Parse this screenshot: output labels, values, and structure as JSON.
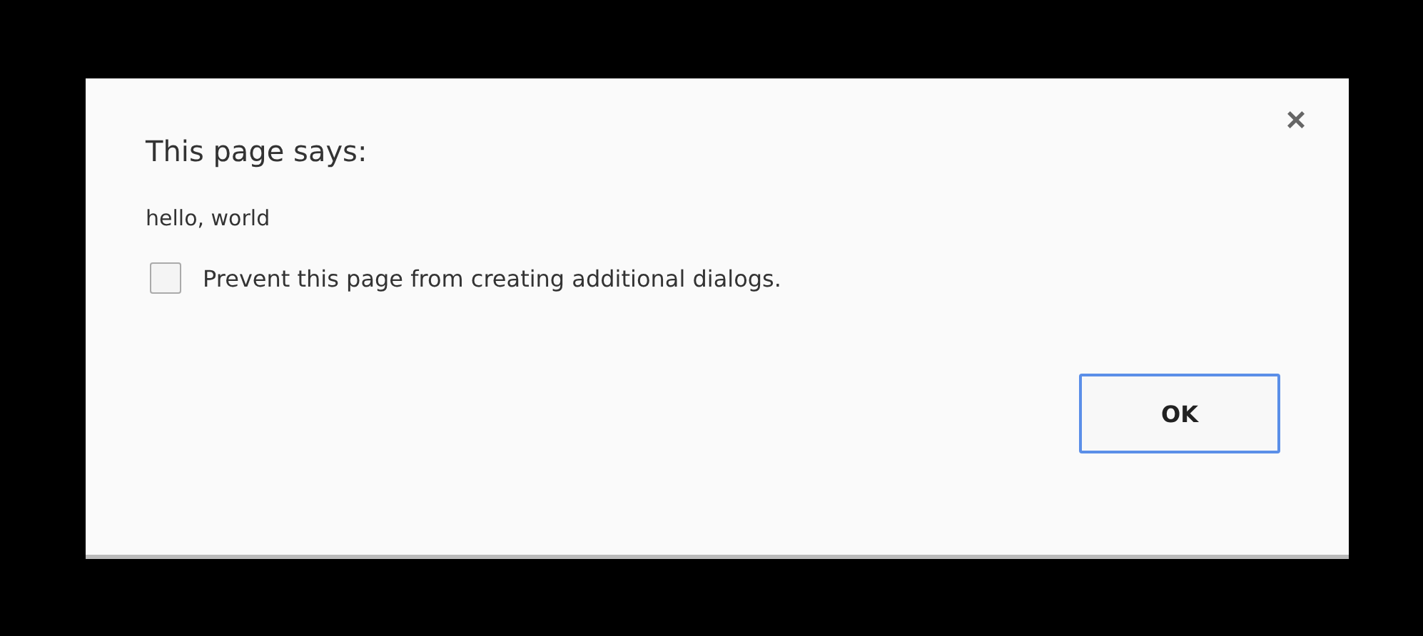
{
  "dialog": {
    "title": "This page says:",
    "close": "×",
    "message": "hello, world",
    "checkbox": {
      "label": "Prevent this page from creating additional dialogs.",
      "checked": false
    },
    "buttons": [
      {
        "label": "OK",
        "selected": true
      }
    ]
  }
}
